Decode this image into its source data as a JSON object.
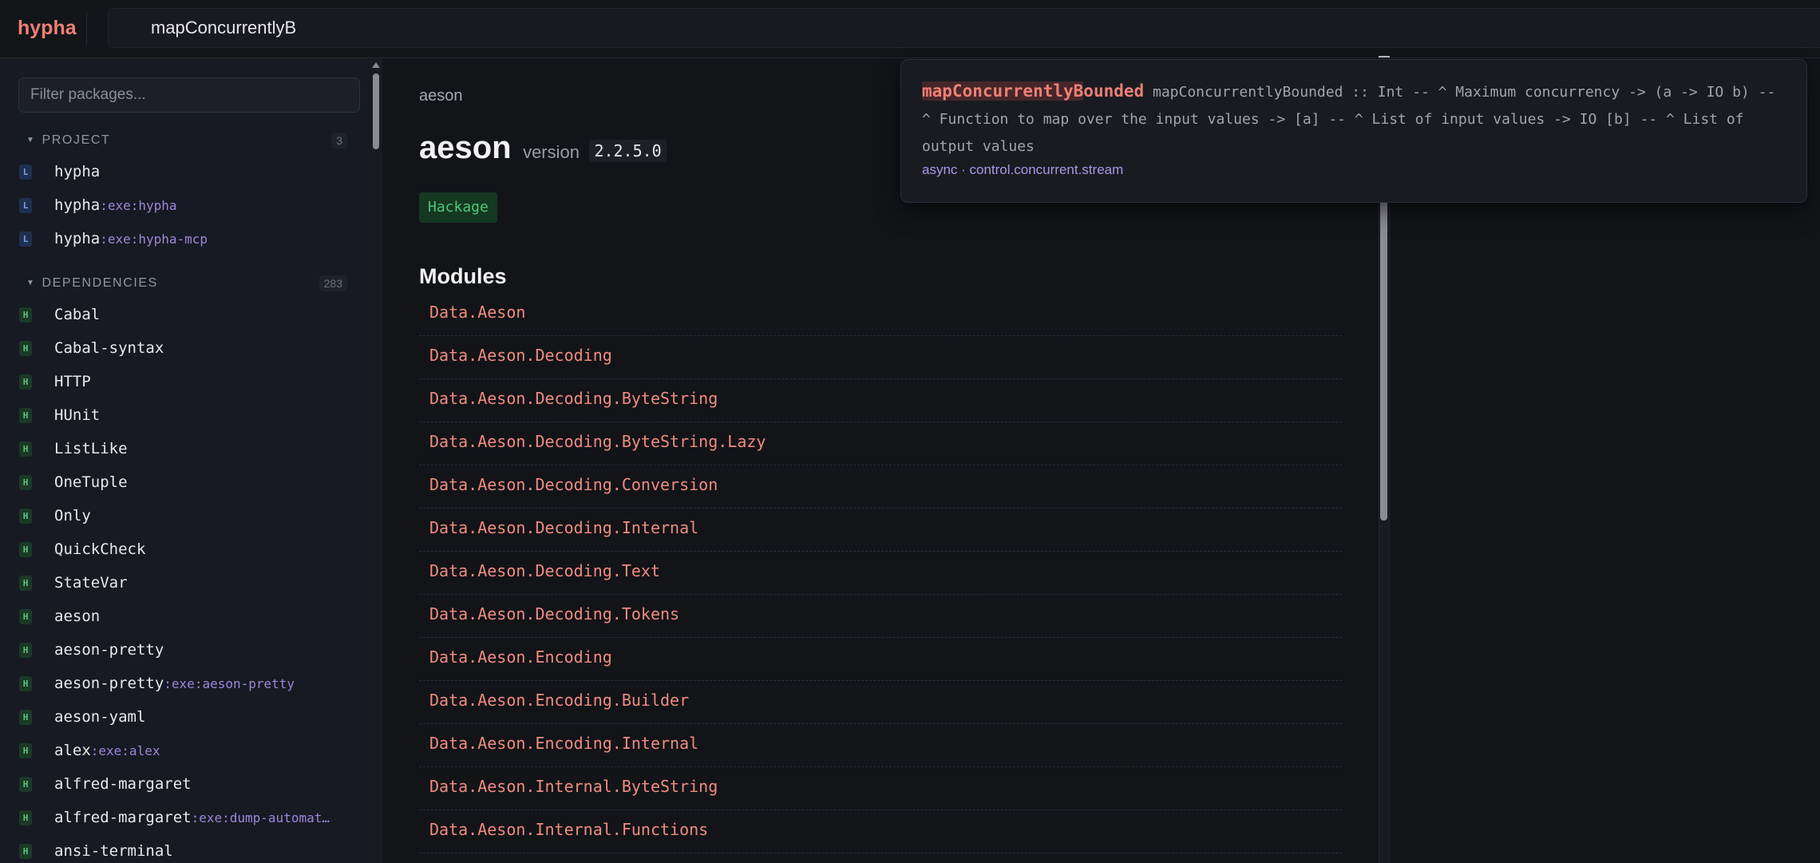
{
  "app": {
    "logo": "hypha"
  },
  "search": {
    "value": "mapConcurrentlyB"
  },
  "sidebar": {
    "filter_placeholder": "Filter packages...",
    "sections": [
      {
        "title": "PROJECT",
        "count": "3",
        "items": [
          {
            "badge": "L",
            "name": "hypha",
            "sub": ""
          },
          {
            "badge": "L",
            "name": "hypha",
            "sub": ":exe:hypha"
          },
          {
            "badge": "L",
            "name": "hypha",
            "sub": ":exe:hypha-mcp"
          }
        ]
      },
      {
        "title": "DEPENDENCIES",
        "count": "283",
        "items": [
          {
            "badge": "H",
            "name": "Cabal",
            "sub": ""
          },
          {
            "badge": "H",
            "name": "Cabal-syntax",
            "sub": ""
          },
          {
            "badge": "H",
            "name": "HTTP",
            "sub": ""
          },
          {
            "badge": "H",
            "name": "HUnit",
            "sub": ""
          },
          {
            "badge": "H",
            "name": "ListLike",
            "sub": ""
          },
          {
            "badge": "H",
            "name": "OneTuple",
            "sub": ""
          },
          {
            "badge": "H",
            "name": "Only",
            "sub": ""
          },
          {
            "badge": "H",
            "name": "QuickCheck",
            "sub": ""
          },
          {
            "badge": "H",
            "name": "StateVar",
            "sub": ""
          },
          {
            "badge": "H",
            "name": "aeson",
            "sub": ""
          },
          {
            "badge": "H",
            "name": "aeson-pretty",
            "sub": ""
          },
          {
            "badge": "H",
            "name": "aeson-pretty",
            "sub": ":exe:aeson-pretty"
          },
          {
            "badge": "H",
            "name": "aeson-yaml",
            "sub": ""
          },
          {
            "badge": "H",
            "name": "alex",
            "sub": ":exe:alex"
          },
          {
            "badge": "H",
            "name": "alfred-margaret",
            "sub": ""
          },
          {
            "badge": "H",
            "name": "alfred-margaret",
            "sub": ":exe:dump-automat…"
          },
          {
            "badge": "H",
            "name": "ansi-terminal",
            "sub": ""
          }
        ]
      }
    ]
  },
  "main": {
    "breadcrumb": "aeson",
    "package_name": "aeson",
    "version_label": "version",
    "version": "2.2.5.0",
    "source_badge": "Hackage",
    "modules_heading": "Modules",
    "modules": [
      "Data.Aeson",
      "Data.Aeson.Decoding",
      "Data.Aeson.Decoding.ByteString",
      "Data.Aeson.Decoding.ByteString.Lazy",
      "Data.Aeson.Decoding.Conversion",
      "Data.Aeson.Decoding.Internal",
      "Data.Aeson.Decoding.Text",
      "Data.Aeson.Decoding.Tokens",
      "Data.Aeson.Encoding",
      "Data.Aeson.Encoding.Builder",
      "Data.Aeson.Encoding.Internal",
      "Data.Aeson.Internal.ByteString",
      "Data.Aeson.Internal.Functions"
    ]
  },
  "popup": {
    "name_match": "mapConcurrentlyB",
    "name_rest": "ounded",
    "signature": "mapConcurrentlyBounded :: Int -- ^ Maximum concurrency -> (a -> IO b) -- ^ Function to map over the input values -> [a] -- ^ List of input values -> IO [b] -- ^ List of output values",
    "meta": "async · control.concurrent.stream"
  },
  "colors": {
    "accent": "#ef7f75",
    "module_link": "#ee8c80",
    "sub_purple": "#9d86d8",
    "hackage_green": "#4ec77a",
    "background": "#131418"
  }
}
